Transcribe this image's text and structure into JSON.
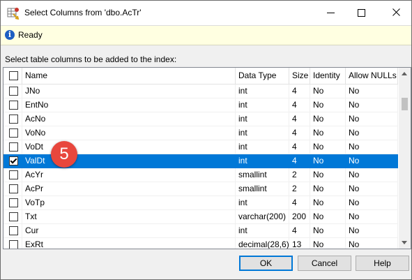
{
  "window": {
    "title": "Select Columns from 'dbo.AcTr'",
    "controls": [
      "minimize-icon",
      "maximize-icon",
      "close-icon"
    ]
  },
  "status": {
    "icon": "info-icon",
    "text": "Ready"
  },
  "instruction": "Select table columns to be added to the index:",
  "grid": {
    "headers": {
      "name": "Name",
      "type": "Data Type",
      "size": "Size",
      "identity": "Identity",
      "nulls": "Allow NULLs"
    },
    "select_all_checked": false,
    "rows": [
      {
        "name": "JNo",
        "type": "int",
        "size": "4",
        "identity": "No",
        "nulls": "No",
        "checked": false,
        "selected": false
      },
      {
        "name": "EntNo",
        "type": "int",
        "size": "4",
        "identity": "No",
        "nulls": "No",
        "checked": false,
        "selected": false
      },
      {
        "name": "AcNo",
        "type": "int",
        "size": "4",
        "identity": "No",
        "nulls": "No",
        "checked": false,
        "selected": false
      },
      {
        "name": "VoNo",
        "type": "int",
        "size": "4",
        "identity": "No",
        "nulls": "No",
        "checked": false,
        "selected": false
      },
      {
        "name": "VoDt",
        "type": "int",
        "size": "4",
        "identity": "No",
        "nulls": "No",
        "checked": false,
        "selected": false
      },
      {
        "name": "ValDt",
        "type": "int",
        "size": "4",
        "identity": "No",
        "nulls": "No",
        "checked": true,
        "selected": true
      },
      {
        "name": "AcYr",
        "type": "smallint",
        "size": "2",
        "identity": "No",
        "nulls": "No",
        "checked": false,
        "selected": false
      },
      {
        "name": "AcPr",
        "type": "smallint",
        "size": "2",
        "identity": "No",
        "nulls": "No",
        "checked": false,
        "selected": false
      },
      {
        "name": "VoTp",
        "type": "int",
        "size": "4",
        "identity": "No",
        "nulls": "No",
        "checked": false,
        "selected": false
      },
      {
        "name": "Txt",
        "type": "varchar(200)",
        "size": "200",
        "identity": "No",
        "nulls": "No",
        "checked": false,
        "selected": false
      },
      {
        "name": "Cur",
        "type": "int",
        "size": "4",
        "identity": "No",
        "nulls": "No",
        "checked": false,
        "selected": false
      },
      {
        "name": "ExRt",
        "type": "decimal(28,6)",
        "size": "13",
        "identity": "No",
        "nulls": "No",
        "checked": false,
        "selected": false
      }
    ]
  },
  "badge": {
    "label": "5",
    "color": "#e8473d"
  },
  "buttons": {
    "ok": "OK",
    "cancel": "Cancel",
    "help": "Help"
  },
  "colors": {
    "selection": "#0078d7",
    "status_bg": "#ffffe1",
    "accent": "#0078d7"
  }
}
